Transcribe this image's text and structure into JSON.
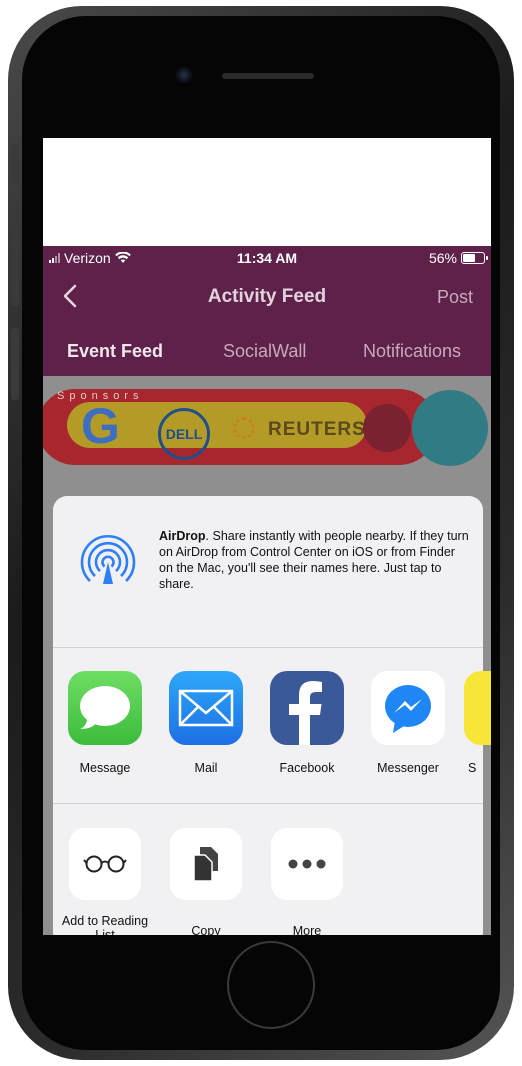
{
  "status_bar": {
    "carrier": "Verizon",
    "time": "11:34 AM",
    "battery": "56%",
    "battery_level": 0.56
  },
  "nav": {
    "title": "Activity Feed",
    "post_label": "Post",
    "back_icon": "chevron-left-icon"
  },
  "tabs": [
    {
      "label": "Event Feed",
      "active": true
    },
    {
      "label": "SocialWall",
      "active": false
    },
    {
      "label": "Notifications",
      "active": false
    }
  ],
  "sponsors": {
    "label": "Sponsors",
    "logos": [
      "G",
      "DELL",
      "REUTERS"
    ]
  },
  "share_sheet": {
    "airdrop_title": "AirDrop",
    "airdrop_text": ". Share instantly with people nearby. If they turn on AirDrop from Control Center on iOS or from Finder on the Mac, you'll see their names here. Just tap to share.",
    "apps": [
      {
        "label": "Message",
        "icon": "message-icon"
      },
      {
        "label": "Mail",
        "icon": "mail-icon"
      },
      {
        "label": "Facebook",
        "icon": "facebook-icon"
      },
      {
        "label": "Messenger",
        "icon": "messenger-icon"
      },
      {
        "label": "S",
        "icon": "app-icon"
      }
    ],
    "actions": [
      {
        "label": "Add to Reading List",
        "icon": "glasses-icon"
      },
      {
        "label": "Copy",
        "icon": "copy-icon"
      },
      {
        "label": "More",
        "icon": "more-icon"
      }
    ]
  },
  "colors": {
    "brand": "#5e2149",
    "sheet": "#f1f1f3"
  }
}
